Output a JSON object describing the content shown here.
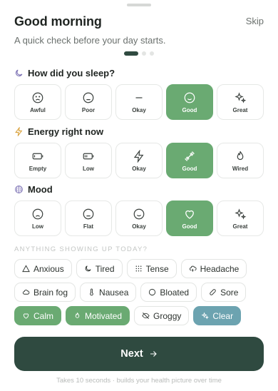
{
  "header": {
    "title": "Good morning",
    "subtitle": "A quick check before your day starts.",
    "skip_label": "Skip"
  },
  "progress": {
    "current_step": 1,
    "total_steps": 3
  },
  "sleep": {
    "title": "How did you sleep?",
    "options": [
      {
        "label": "Awful",
        "icon": "frown-icon"
      },
      {
        "label": "Poor",
        "icon": "neutral-face-icon"
      },
      {
        "label": "Okay",
        "icon": "dash-icon"
      },
      {
        "label": "Good",
        "icon": "smile-icon",
        "selected": true
      },
      {
        "label": "Great",
        "icon": "sparkles-icon"
      }
    ]
  },
  "energy": {
    "title": "Energy right now",
    "options": [
      {
        "label": "Empty",
        "icon": "battery-empty-icon"
      },
      {
        "label": "Low",
        "icon": "battery-low-icon"
      },
      {
        "label": "Okay",
        "icon": "lightning-icon"
      },
      {
        "label": "Good",
        "icon": "dumbbell-icon",
        "selected": true
      },
      {
        "label": "Wired",
        "icon": "flame-icon"
      }
    ]
  },
  "mood": {
    "title": "Mood",
    "options": [
      {
        "label": "Low",
        "icon": "frown-icon"
      },
      {
        "label": "Flat",
        "icon": "neutral-face-icon"
      },
      {
        "label": "Okay",
        "icon": "smile-icon"
      },
      {
        "label": "Good",
        "icon": "heart-icon",
        "selected": true
      },
      {
        "label": "Great",
        "icon": "sparkles-icon"
      }
    ]
  },
  "symptoms": {
    "title": "ANYTHING SHOWING UP TODAY?",
    "chips": [
      {
        "label": "Anxious",
        "icon": "triangle-alert-icon"
      },
      {
        "label": "Tired",
        "icon": "moon-icon"
      },
      {
        "label": "Tense",
        "icon": "dots-grid-icon"
      },
      {
        "label": "Headache",
        "icon": "cloud-lightning-icon"
      },
      {
        "label": "Brain fog",
        "icon": "cloud-icon"
      },
      {
        "label": "Nausea",
        "icon": "thermometer-icon"
      },
      {
        "label": "Bloated",
        "icon": "circle-icon"
      },
      {
        "label": "Sore",
        "icon": "bandage-icon"
      },
      {
        "label": "Calm",
        "icon": "heart-icon",
        "selected": "green"
      },
      {
        "label": "Motivated",
        "icon": "flame-icon",
        "selected": "green"
      },
      {
        "label": "Groggy",
        "icon": "eye-off-icon"
      },
      {
        "label": "Clear",
        "icon": "sparkles-icon",
        "selected": "teal"
      }
    ]
  },
  "next_button": {
    "label": "Next",
    "icon": "arrow-right-icon"
  },
  "footer": "Takes 10 seconds · builds your health picture over time",
  "colors": {
    "primary_dark": "#2f4a40",
    "selected_green": "#6aaa72",
    "selected_teal": "#6ca3b0"
  }
}
